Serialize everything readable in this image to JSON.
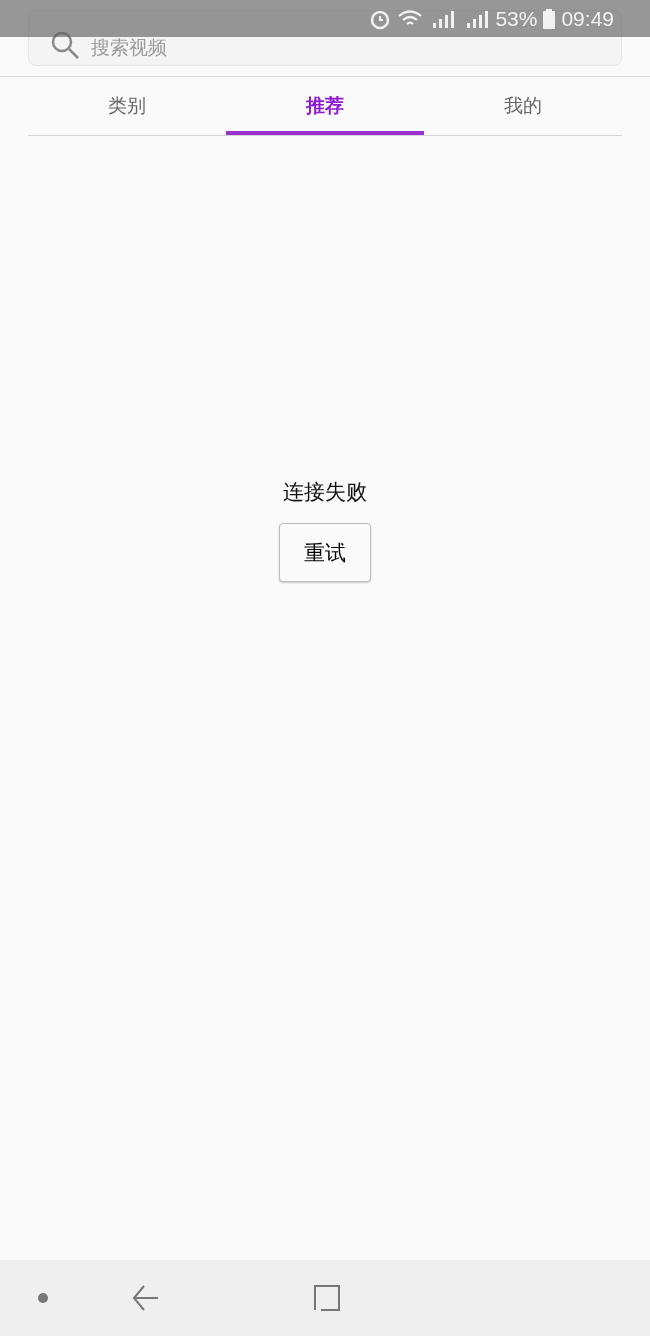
{
  "status_bar": {
    "battery": "53%",
    "time": "09:49"
  },
  "search": {
    "placeholder": "搜索视频"
  },
  "tabs": [
    {
      "label": "类别",
      "selected": false
    },
    {
      "label": "推荐",
      "selected": true
    },
    {
      "label": "我的",
      "selected": false
    }
  ],
  "error": {
    "message": "连接失败",
    "button": "重试"
  }
}
